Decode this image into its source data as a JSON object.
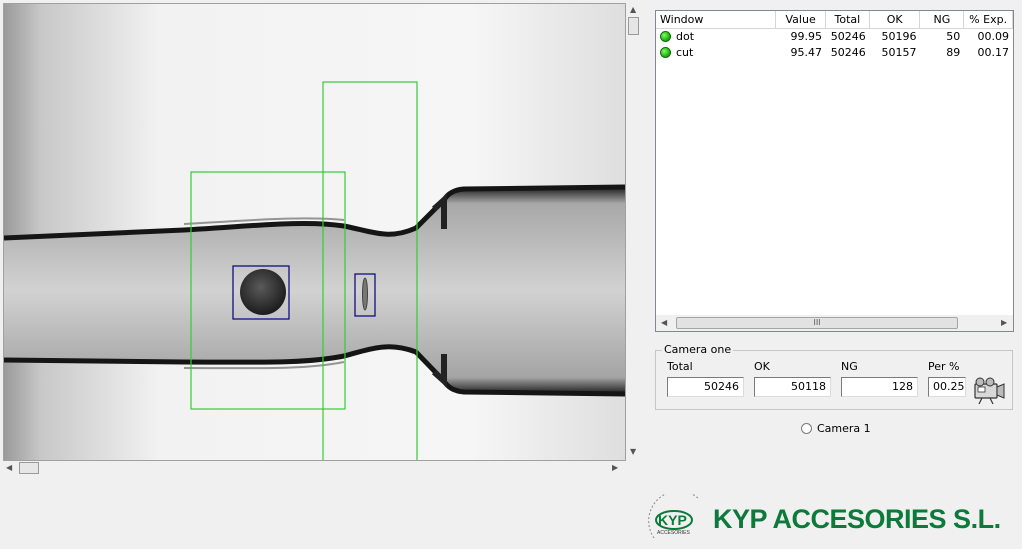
{
  "viewer": {
    "inspection_windows": [
      {
        "name": "dot-region",
        "color": "#33cc33"
      },
      {
        "name": "cut-region",
        "color": "#33cc33"
      }
    ],
    "detections": [
      {
        "name": "dot-detection",
        "color": "#000080"
      },
      {
        "name": "cut-detection",
        "color": "#000080"
      }
    ]
  },
  "list": {
    "columns": [
      "Window",
      "Value",
      "Total",
      "OK",
      "NG",
      "% Exp."
    ],
    "rows": [
      {
        "window": "dot",
        "value": "99.95",
        "total": "50246",
        "ok": "50196",
        "ng": "50",
        "exp": "00.09",
        "status_color": "#22aa11"
      },
      {
        "window": "cut",
        "value": "95.47",
        "total": "50246",
        "ok": "50157",
        "ng": "89",
        "exp": "00.17",
        "status_color": "#22aa11"
      }
    ],
    "scroll_thumb_glyph": "III"
  },
  "camera_group": {
    "title": "Camera one",
    "total_label": "Total",
    "ok_label": "OK",
    "ng_label": "NG",
    "per_label": "Per %",
    "total_value": "50246",
    "ok_value": "50118",
    "ng_value": "128",
    "per_value": "00.25",
    "icon": "camera-icon"
  },
  "camera_select": {
    "label": "Camera 1",
    "selected": false
  },
  "branding": {
    "company": "KYP ACCESORIES S.L.",
    "logo_text": "KYP",
    "logo_subtext": "ACCESORIES",
    "brand_color": "#0c7a3a"
  }
}
